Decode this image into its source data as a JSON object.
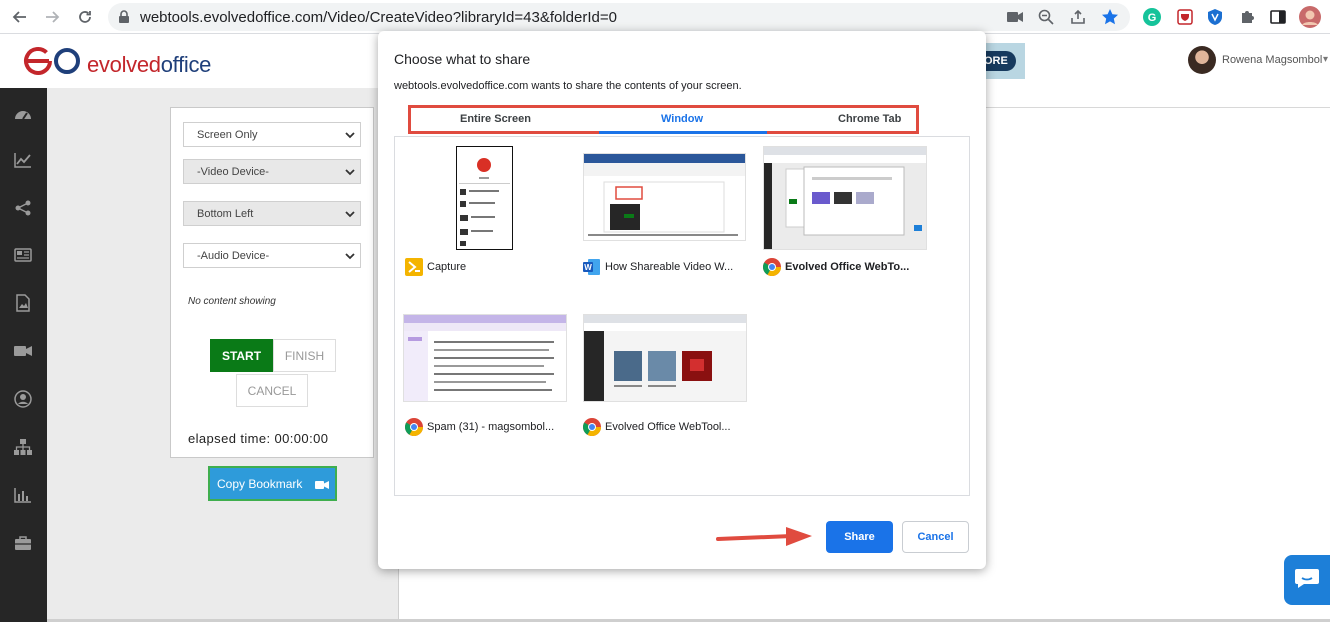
{
  "browser": {
    "url": "webtools.evolvedoffice.com/Video/CreateVideo?libraryId=43&folderId=0"
  },
  "header": {
    "logo_text_a": "evolved",
    "logo_text_b": "office",
    "more_label": "ORE",
    "user_name": "Rowena Magsombol"
  },
  "recorder": {
    "screen_select": "Screen Only",
    "video_select": "-Video Device-",
    "position_select": "Bottom Left",
    "audio_select": "-Audio Device-",
    "no_content": "No content showing",
    "start_label": "START",
    "finish_label": "FINISH",
    "cancel_label": "CANCEL",
    "elapsed": "elapsed time: 00:00:00",
    "copy_bookmark": "Copy Bookmark"
  },
  "dialog": {
    "title": "Choose what to share",
    "subtitle": "webtools.evolvedoffice.com wants to share the contents of your screen.",
    "tabs": [
      {
        "label": "Entire Screen"
      },
      {
        "label": "Window"
      },
      {
        "label": "Chrome Tab"
      }
    ],
    "windows": [
      {
        "label": "Capture",
        "icon": "capture-app-icon"
      },
      {
        "label": "How Shareable Video W...",
        "icon": "word-icon"
      },
      {
        "label": "Evolved Office WebTo...",
        "icon": "chrome-icon"
      },
      {
        "label": "Spam (31) - magsombol...",
        "icon": "chrome-icon"
      },
      {
        "label": "Evolved Office WebTool...",
        "icon": "chrome-icon"
      }
    ],
    "share_label": "Share",
    "cancel_label": "Cancel"
  },
  "colors": {
    "accent": "#1a73e8",
    "highlight": "#e04b3f",
    "start_green": "#0a7a17",
    "sidebar": "#262626"
  }
}
